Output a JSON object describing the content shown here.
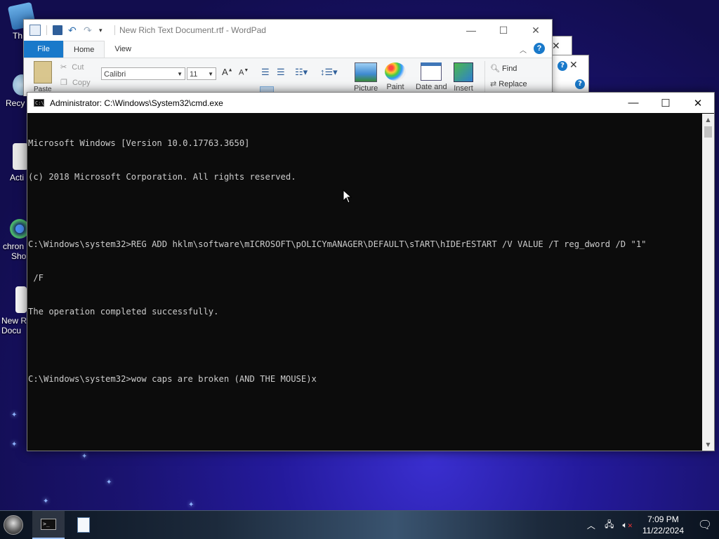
{
  "desktop": {
    "icons": [
      {
        "label": "Th",
        "name": "this-pc-icon"
      },
      {
        "label": "Recy",
        "name": "recycle-bin-icon"
      },
      {
        "label": "Acti",
        "name": "activate-icon"
      },
      {
        "label": "chron",
        "label2": "Sho",
        "name": "chrome-shortcut-icon"
      },
      {
        "label": "New R",
        "label2": "Docu",
        "name": "new-document-icon"
      }
    ]
  },
  "wordpad": {
    "title": "New Rich Text Document.rtf - WordPad",
    "tabs": {
      "file": "File",
      "home": "Home",
      "view": "View"
    },
    "clipboard": {
      "paste": "Paste",
      "cut": "Cut",
      "copy": "Copy"
    },
    "font": {
      "family": "Calibri",
      "size": "11"
    },
    "insert": {
      "picture": "Picture",
      "paint": "Paint",
      "datetime": "Date and",
      "object": "Insert"
    },
    "editing": {
      "find": "Find",
      "replace": "Replace"
    },
    "help": "?"
  },
  "cmd": {
    "title": "Administrator: C:\\Windows\\System32\\cmd.exe",
    "lines": [
      "Microsoft Windows [Version 10.0.17763.3650]",
      "(c) 2018 Microsoft Corporation. All rights reserved.",
      "",
      "C:\\Windows\\system32>REG ADD hklm\\software\\mICROSOFT\\pOLICYmANAGER\\DEFAULT\\sTART\\hIDErESTART /V VALUE /T reg_dword /D \"1\"",
      " /F",
      "The operation completed successfully.",
      "",
      "C:\\Windows\\system32>wow caps are broken (AND THE MOUSE)x"
    ]
  },
  "taskbar": {
    "apps": [
      {
        "name": "cmd-taskbar-button",
        "icon": "cmd-icon"
      },
      {
        "name": "wordpad-taskbar-button",
        "icon": "wordpad-icon"
      }
    ],
    "clock": {
      "time": "7:09 PM",
      "date": "11/22/2024"
    }
  }
}
